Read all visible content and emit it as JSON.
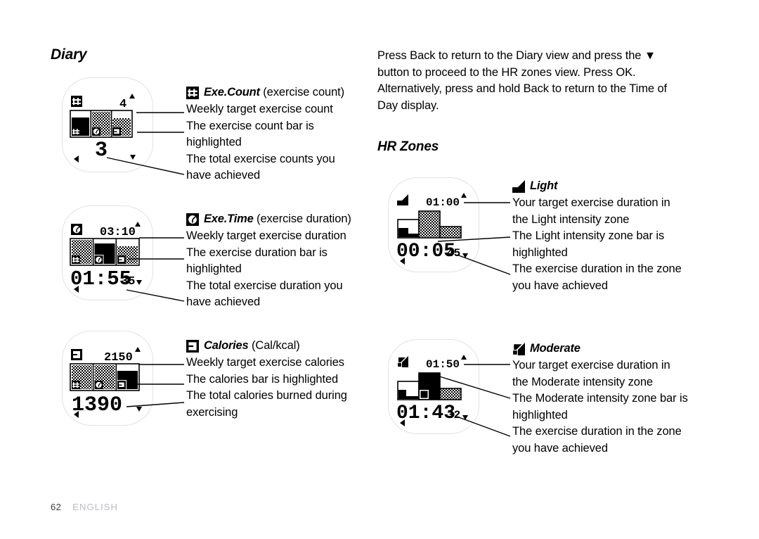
{
  "document": {
    "page_number": "62",
    "language_label": "ENGLISH"
  },
  "sections": {
    "diary": {
      "heading": "Diary",
      "items": [
        {
          "icon": "exe-count-lcd-icon",
          "title": "Exe.Count",
          "title_suffix": "(exercise count)",
          "notes": [
            "Weekly target exercise count",
            "The exercise count bar is highlighted",
            "The total exercise counts you have achieved"
          ],
          "watch": {
            "header_icon": "exe-count-lcd-icon",
            "header_value": "4",
            "big_value": "3",
            "small_value": "",
            "up_arrow": "▲",
            "down_arrow": "▼",
            "left_arrow": "◀",
            "bars": [
              {
                "label": "count-bar",
                "fill": "solid",
                "height_pct": 62,
                "highlighted": true
              },
              {
                "label": "time-bar",
                "fill": "dither",
                "height_pct": 100,
                "highlighted": false
              },
              {
                "label": "calorie-bar",
                "fill": "dither",
                "height_pct": 68,
                "highlighted": false
              }
            ]
          }
        },
        {
          "icon": "exe-time-lcd-icon",
          "title": "Exe.Time",
          "title_suffix": "(exercise duration)",
          "notes": [
            "Weekly target exercise duration",
            "The exercise duration bar is highlighted",
            "The total exercise duration you have achieved"
          ],
          "watch": {
            "header_icon": "exe-time-lcd-icon",
            "header_value": "03:10",
            "big_value": "01:55",
            "small_value": "35",
            "up_arrow": "▲",
            "down_arrow": "▼",
            "left_arrow": "◀",
            "bars": [
              {
                "label": "count-bar",
                "fill": "dither",
                "height_pct": 100,
                "highlighted": false
              },
              {
                "label": "time-bar",
                "fill": "solid",
                "height_pct": 72,
                "highlighted": true
              },
              {
                "label": "calorie-bar",
                "fill": "dither",
                "height_pct": 68,
                "highlighted": false
              }
            ]
          }
        },
        {
          "icon": "calories-lcd-icon",
          "title": "Calories",
          "title_suffix": "(Cal/kcal)",
          "notes": [
            "Weekly target exercise calories",
            "The calories bar is highlighted",
            "The total calories burned during exercising"
          ],
          "watch": {
            "header_icon": "calories-lcd-icon",
            "header_value": "2150",
            "big_value": "1390",
            "small_value": "",
            "up_arrow": "▲",
            "down_arrow": "▼",
            "left_arrow": "◀",
            "bars": [
              {
                "label": "count-bar",
                "fill": "dither",
                "height_pct": 100,
                "highlighted": false
              },
              {
                "label": "time-bar",
                "fill": "dither",
                "height_pct": 100,
                "highlighted": false
              },
              {
                "label": "calorie-bar",
                "fill": "solid",
                "height_pct": 62,
                "highlighted": true
              }
            ]
          }
        }
      ]
    },
    "hr_zones": {
      "heading": "HR Zones",
      "intro": "Press Back to return to the Diary view and press the ▼ button to proceed to the HR zones view. Press OK. Alternatively, press and hold Back to return to the Time of Day display.",
      "items": [
        {
          "icon": "light-zone-lcd-icon",
          "title": "Light",
          "title_suffix": "",
          "notes": [
            "Your target exercise duration in the Light intensity zone",
            "The Light intensity zone bar is highlighted",
            "The exercise duration in the zone you have achieved"
          ],
          "watch": {
            "header_icon": "light-zone-lcd-icon",
            "header_value": "01:00",
            "big_value": "00:05",
            "small_value": "45",
            "up_arrow": "▲",
            "down_arrow": "▼",
            "left_arrow": "◀",
            "bars": [
              {
                "label": "light-bar",
                "fill": "solid",
                "height_pct": 40,
                "highlighted": true
              },
              {
                "label": "moderate-bar",
                "fill": "dither",
                "height_pct": 100,
                "highlighted": false
              },
              {
                "label": "hard-bar",
                "fill": "dither",
                "height_pct": 52,
                "highlighted": false
              }
            ]
          }
        },
        {
          "icon": "moderate-zone-lcd-icon",
          "title": "Moderate",
          "title_suffix": "",
          "notes": [
            "Your target exercise duration in the Moderate intensity zone",
            "The Moderate intensity zone bar is highlighted",
            "The exercise duration in the zone you have achieved"
          ],
          "watch": {
            "header_icon": "moderate-zone-lcd-icon",
            "header_value": "01:50",
            "big_value": "01:43",
            "small_value": "32",
            "up_arrow": "▲",
            "down_arrow": "▼",
            "left_arrow": "◀",
            "bars": [
              {
                "label": "light-bar",
                "fill": "dither",
                "height_pct": 40,
                "highlighted": false
              },
              {
                "label": "moderate-bar",
                "fill": "solid",
                "height_pct": 100,
                "highlighted": true
              },
              {
                "label": "hard-bar",
                "fill": "dither",
                "height_pct": 52,
                "highlighted": false
              }
            ]
          }
        }
      ]
    }
  },
  "colors": {
    "ink": "#000000",
    "watch_outline": "#e2e2e4",
    "page_num": "#3a3a3a",
    "lang": "#b9bcc6",
    "background": "#ffffff"
  }
}
